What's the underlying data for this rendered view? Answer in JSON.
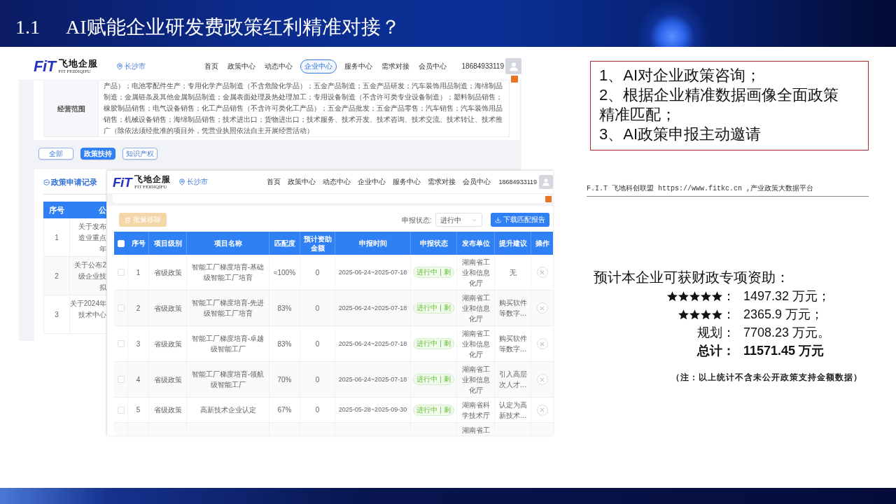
{
  "title_bar": {
    "number": "1.1",
    "title": "AI赋能企业研发费政策红利精准对接？"
  },
  "back_screenshot": {
    "nav": {
      "logo": {
        "mark": "FiT",
        "name": "飞地企服",
        "tagline": "FIT FEIDIQIFU"
      },
      "location": "长沙市",
      "items": [
        {
          "label": "首页",
          "selected": false
        },
        {
          "label": "政策中心",
          "selected": false
        },
        {
          "label": "动态中心",
          "selected": false
        },
        {
          "label": "企业中心",
          "selected": true
        },
        {
          "label": "服务中心",
          "selected": false
        },
        {
          "label": "需求对接",
          "selected": false
        },
        {
          "label": "会员中心",
          "selected": false
        }
      ],
      "phone": "18684933119"
    },
    "business_scope": {
      "label": "经营范围",
      "value": "产品）；电池零配件生产；专用化学产品制造（不含危险化学品）；五金产品制造；五金产品研发；汽车装饰用品制造；海绵制品制造；金属链条及其他金属制品制造；金属表面处理及热处理加工；专用设备制造（不含许可类专业设备制造）；塑料制品销售；橡胶制品销售；电气设备销售；化工产品销售（不含许可类化工产品）；五金产品批发；五金产品零售；汽车销售；汽车装饰用品销售；机械设备销售；海绵制品销售；技术进出口；货物进出口；技术服务、技术开发、技术咨询、技术交流、技术转让、技术推广（除依法须经批准的项目外，凭营业执照依法自主开展经营活动）"
    },
    "tabs": [
      {
        "label": "全部",
        "selected": false
      },
      {
        "label": "政策扶持",
        "selected": true
      },
      {
        "label": "知识产权",
        "selected": false
      }
    ],
    "records": {
      "title": "政策申请记录",
      "columns": [
        "序号",
        "公"
      ],
      "rows": [
        {
          "index": "1",
          "lines": [
            "关于发布",
            "造业重点",
            "年"
          ]
        },
        {
          "index": "2",
          "lines": [
            "关于公布2",
            "级企业技",
            "拟"
          ]
        },
        {
          "index": "3",
          "lines": [
            "关于2024年",
            "技术中心"
          ]
        }
      ]
    }
  },
  "front_screenshot": {
    "nav": {
      "logo": {
        "mark": "FiT",
        "name": "飞地企服",
        "tagline": "FIT FEIDIQIFU"
      },
      "location": "长沙市",
      "items": [
        {
          "label": "首页",
          "selected": false
        },
        {
          "label": "政策中心",
          "selected": false
        },
        {
          "label": "动态中心",
          "selected": false
        },
        {
          "label": "企业中心",
          "selected": false
        },
        {
          "label": "服务中心",
          "selected": false
        },
        {
          "label": "需求对接",
          "selected": false
        },
        {
          "label": "会员中心",
          "selected": false
        }
      ],
      "phone": "18684933119"
    },
    "toolbar": {
      "remove_button": {
        "label": "批量移除",
        "disabled": true
      },
      "status_label": "申报状态:",
      "status_select": {
        "value": "进行中"
      },
      "download_button": {
        "label": "下载匹配报告"
      }
    },
    "table": {
      "header_checkbox": {
        "checked": false
      },
      "columns": [
        "序号",
        "项目级别",
        "项目名称",
        "匹配度",
        "预计资助金额",
        "申报时间",
        "申报状态",
        "发布单位",
        "提升建议",
        "操作"
      ],
      "rows": [
        {
          "kind": "full",
          "checked": false,
          "index": "1",
          "tier": "省级政策",
          "name": "智能工厂梯度培育-基础级智能工厂培育",
          "match": "≈100%",
          "funding": "0",
          "period": "2025-06-24~2025-07-18",
          "status": "进行中 | 剩",
          "publisher": "湖南省工业和信息化厅",
          "suggestion": "无"
        },
        {
          "kind": "full",
          "checked": false,
          "index": "2",
          "tier": "省级政策",
          "name": "智能工厂梯度培育-先进级智能工厂培育",
          "match": "83%",
          "funding": "0",
          "period": "2025-06-24~2025-07-18",
          "status": "进行中 | 剩",
          "publisher": "湖南省工业和信息化厅",
          "suggestion": "购买软件等数字…"
        },
        {
          "kind": "full",
          "checked": false,
          "index": "3",
          "tier": "省级政策",
          "name": "智能工厂梯度培育-卓越级智能工厂",
          "match": "83%",
          "funding": "0",
          "period": "2025-06-24~2025-07-18",
          "status": "进行中 | 剩",
          "publisher": "湖南省工业和信息化厅",
          "suggestion": "购买软件等数字…"
        },
        {
          "kind": "full",
          "checked": false,
          "index": "4",
          "tier": "省级政策",
          "name": "智能工厂梯度培育-领航级智能工厂",
          "match": "70%",
          "funding": "0",
          "period": "2025-06-24~2025-07-18",
          "status": "进行中 | 剩",
          "publisher": "湖南省工业和信息化厅",
          "suggestion": "引入高层次人才…"
        },
        {
          "kind": "full",
          "checked": false,
          "index": "5",
          "tier": "省级政策",
          "name": "高新技术企业认定",
          "match": "67%",
          "funding": "0",
          "period": "2025-05-28~2025-09-30",
          "status": "进行中 | 剩",
          "publisher": "湖南省科学技术厅",
          "suggestion": "认定为高新技术…"
        },
        {
          "kind": "cut",
          "publisher": "湖南省工"
        }
      ]
    }
  },
  "highlights": {
    "items": [
      "1、AI对企业政策咨询；",
      "2、根据企业精准数据画像全面政策精准匹配；",
      "3、AI政策申报主动邀请"
    ]
  },
  "document": {
    "header": "F.I.T 飞地科创联盟 https://www.fitkc.cn ,产业政策大数据平台",
    "heading": "预计本企业可获财政专项资助：",
    "lines": [
      {
        "kind": "stars",
        "stars": 5,
        "label": "：",
        "value": "1497.32 万元；"
      },
      {
        "kind": "stars",
        "stars": 4,
        "label": "：",
        "value": "2365.9 万元；"
      },
      {
        "kind": "plain",
        "label": "规划：",
        "value": "7708.23 万元。"
      },
      {
        "kind": "total",
        "label": "总计：",
        "value": "11571.45 万元"
      }
    ],
    "note": "（注：以上统计不含未公开政策支持金额数据）"
  }
}
